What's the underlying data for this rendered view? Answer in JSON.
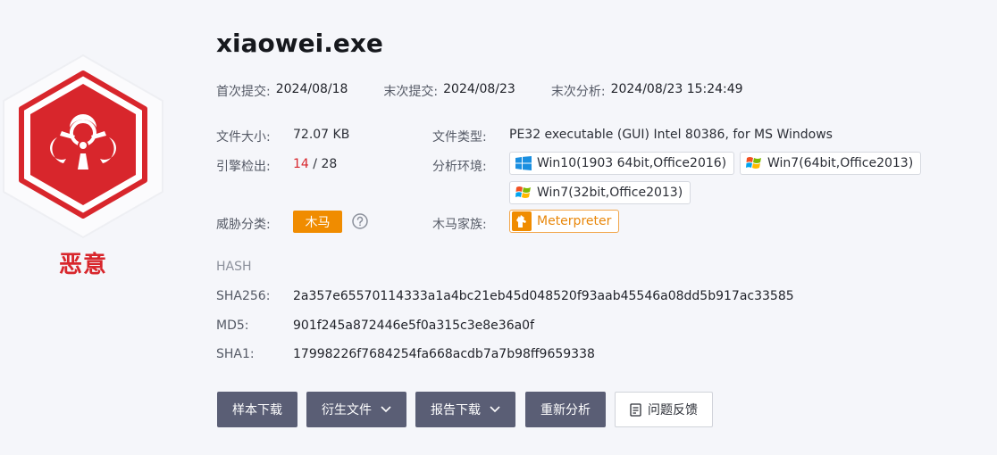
{
  "verdict": {
    "label": "恶意",
    "color": "#d8262c",
    "icon": "biohazard-icon"
  },
  "file": {
    "name": "xiaowei.exe"
  },
  "submission": {
    "first_submit_label": "首次提交:",
    "first_submit": "2024/08/18",
    "last_submit_label": "末次提交:",
    "last_submit": "2024/08/23",
    "last_analysis_label": "末次分析:",
    "last_analysis": "2024/08/23 15:24:49"
  },
  "info": {
    "size_label": "文件大小:",
    "size": "72.07 KB",
    "type_label": "文件类型:",
    "type": "PE32 executable (GUI) Intel 80386, for MS Windows",
    "engine_label": "引擎检出:",
    "engine_hits": "14",
    "engine_sep": " / ",
    "engine_total": "28",
    "env_label": "分析环境:",
    "environments": [
      {
        "label": "Win10(1903 64bit,Office2016)",
        "icon": "windows10-icon"
      },
      {
        "label": "Win7(64bit,Office2013)",
        "icon": "windows7-icon"
      },
      {
        "label": "Win7(32bit,Office2013)",
        "icon": "windows7-icon"
      }
    ],
    "threat_label": "威胁分类:",
    "threat": "木马",
    "threat_color": "#f08c00",
    "family_label": "木马家族:",
    "family": "Meterpreter"
  },
  "hash": {
    "heading": "HASH",
    "sha256_label": "SHA256:",
    "sha256": "2a357e65570114333a1a4bc21eb45d048520f93aab45546a08dd5b917ac33585",
    "md5_label": "MD5:",
    "md5": "901f245a872446e5f0a315c3e8e36a0f",
    "sha1_label": "SHA1:",
    "sha1": "17998226f7684254fa668acdb7a7b98ff9659338"
  },
  "actions": {
    "download_sample": "样本下载",
    "derived_files": "衍生文件",
    "report_download": "报告下载",
    "reanalyze": "重新分析",
    "feedback": "问题反馈"
  }
}
